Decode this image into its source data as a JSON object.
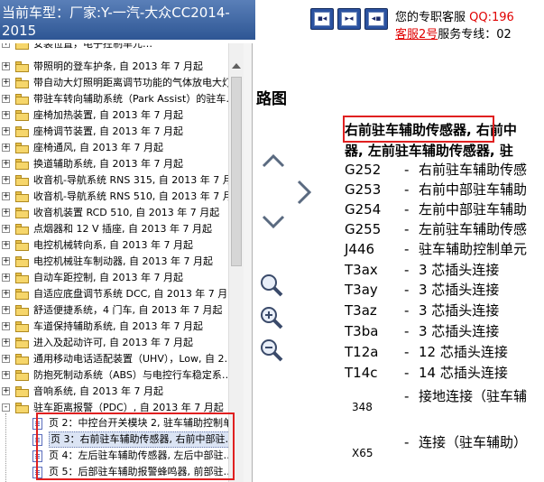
{
  "header": {
    "title": "当前车型：厂家:Y-一汽-大众CC2014-2015",
    "buttons": [
      {
        "name": "prev-page-button",
        "glyph": "◂"
      },
      {
        "name": "fit-page-button",
        "glyph": "▸◂"
      },
      {
        "name": "next-page-button",
        "glyph": "◂"
      }
    ],
    "service": {
      "intro": "您的专职客服",
      "qq": "QQ:196",
      "agent": "客服2号",
      "hotline": "服务专线：02"
    }
  },
  "tree": {
    "items": [
      {
        "label": "安装位置，电子控制单元…",
        "expander": "+"
      },
      {
        "label": "带照明的登车护条, 自 2013 年 7 月起",
        "expander": "+"
      },
      {
        "label": "带自动大灯照明距离调节功能的气体放电大灯…",
        "expander": "+"
      },
      {
        "label": "带驻车转向辅助系统（Park Assist）的驻车…",
        "expander": "+"
      },
      {
        "label": "座椅加热装置, 自 2013 年 7 月起",
        "expander": "+"
      },
      {
        "label": "座椅调节装置, 自 2013 年 7 月起",
        "expander": "+"
      },
      {
        "label": "座椅通风, 自 2013 年 7 月起",
        "expander": "+"
      },
      {
        "label": "换道辅助系统, 自 2013 年 7 月起",
        "expander": "+"
      },
      {
        "label": "收音机-导航系统 RNS 315, 自 2013 年 7 月…",
        "expander": "+"
      },
      {
        "label": "收音机-导航系统 RNS 510, 自 2013 年 7 月…",
        "expander": "+"
      },
      {
        "label": "收音机装置 RCD 510, 自 2013 年 7 月起",
        "expander": "+"
      },
      {
        "label": "点烟器和 12 V 插座, 自 2013 年 7 月起",
        "expander": "+"
      },
      {
        "label": "电控机械转向系, 自 2013 年 7 月起",
        "expander": "+"
      },
      {
        "label": "电控机械驻车制动器, 自 2013 年 7 月起",
        "expander": "+"
      },
      {
        "label": "自动车距控制, 自 2013 年 7 月起",
        "expander": "+"
      },
      {
        "label": "自适应底盘调节系统 DCC, 自 2013 年 7 月…",
        "expander": "+"
      },
      {
        "label": "舒适便捷系统，4 门车, 自 2013 年 7 月起",
        "expander": "+"
      },
      {
        "label": "车道保持辅助系统, 自 2013 年 7 月起",
        "expander": "+"
      },
      {
        "label": "进入及起动许可, 自 2013 年 7 月起",
        "expander": "+"
      },
      {
        "label": "通用移动电话适配装置（UHV），Low, 自 2…",
        "expander": "+"
      },
      {
        "label": "防抱死制动系统（ABS）与电控行车稳定系…",
        "expander": "+"
      },
      {
        "label": "音响系统, 自 2013 年 7 月起",
        "expander": "+"
      },
      {
        "label": "驻车距离报警（PDC）, 自 2013 年 7 月起",
        "expander": "-"
      }
    ],
    "children": [
      {
        "label": "页 2：中控台开关模块 2, 驻车辅助控制单…",
        "selected": false
      },
      {
        "label": "页 3：右前驻车辅助传感器, 右前中部驻…",
        "selected": true
      },
      {
        "label": "页 4：左后驻车辅助传感器, 左后中部驻…",
        "selected": false
      },
      {
        "label": "页 5：后部驻车辅助报警蜂鸣器, 前部驻…",
        "selected": false
      }
    ]
  },
  "content": {
    "section_heading": "路图",
    "heading_line1_boxed": "右前驻车辅助传感器,",
    "heading_line1_rest": " 右前中",
    "heading_line2": "器, 左前驻车辅助传感器, 驻",
    "legend": [
      {
        "code": "G252",
        "desc": "右前驻车辅助传感"
      },
      {
        "code": "G253",
        "desc": "右前中部驻车辅助"
      },
      {
        "code": "G254",
        "desc": "左前中部驻车辅助"
      },
      {
        "code": "G255",
        "desc": "左前驻车辅助传感"
      },
      {
        "code": "J446",
        "desc": "驻车辅助控制单元"
      },
      {
        "code": "T3ax",
        "desc": "3 芯插头连接"
      },
      {
        "code": "T3ay",
        "desc": "3 芯插头连接"
      },
      {
        "code": "T3az",
        "desc": "3 芯插头连接"
      },
      {
        "code": "T3ba",
        "desc": "3 芯插头连接"
      },
      {
        "code": "T12a",
        "desc": "12 芯插头连接"
      },
      {
        "code": "T14c",
        "desc": "14 芯插头连接"
      },
      {
        "code": "348",
        "desc": "接地连接（驻车辅"
      },
      {
        "code": "X65",
        "desc": "连接（驻车辅助）"
      }
    ],
    "tools": [
      {
        "name": "scroll-up-icon"
      },
      {
        "name": "next-page-icon"
      },
      {
        "name": "scroll-down-icon"
      },
      {
        "name": "zoom-fit-icon"
      },
      {
        "name": "zoom-in-icon"
      },
      {
        "name": "zoom-out-icon"
      }
    ]
  },
  "colors": {
    "title_bg": "#2e5694",
    "highlight": "#e02020",
    "service_red": "#e00000",
    "folder": "#f6d66b"
  }
}
